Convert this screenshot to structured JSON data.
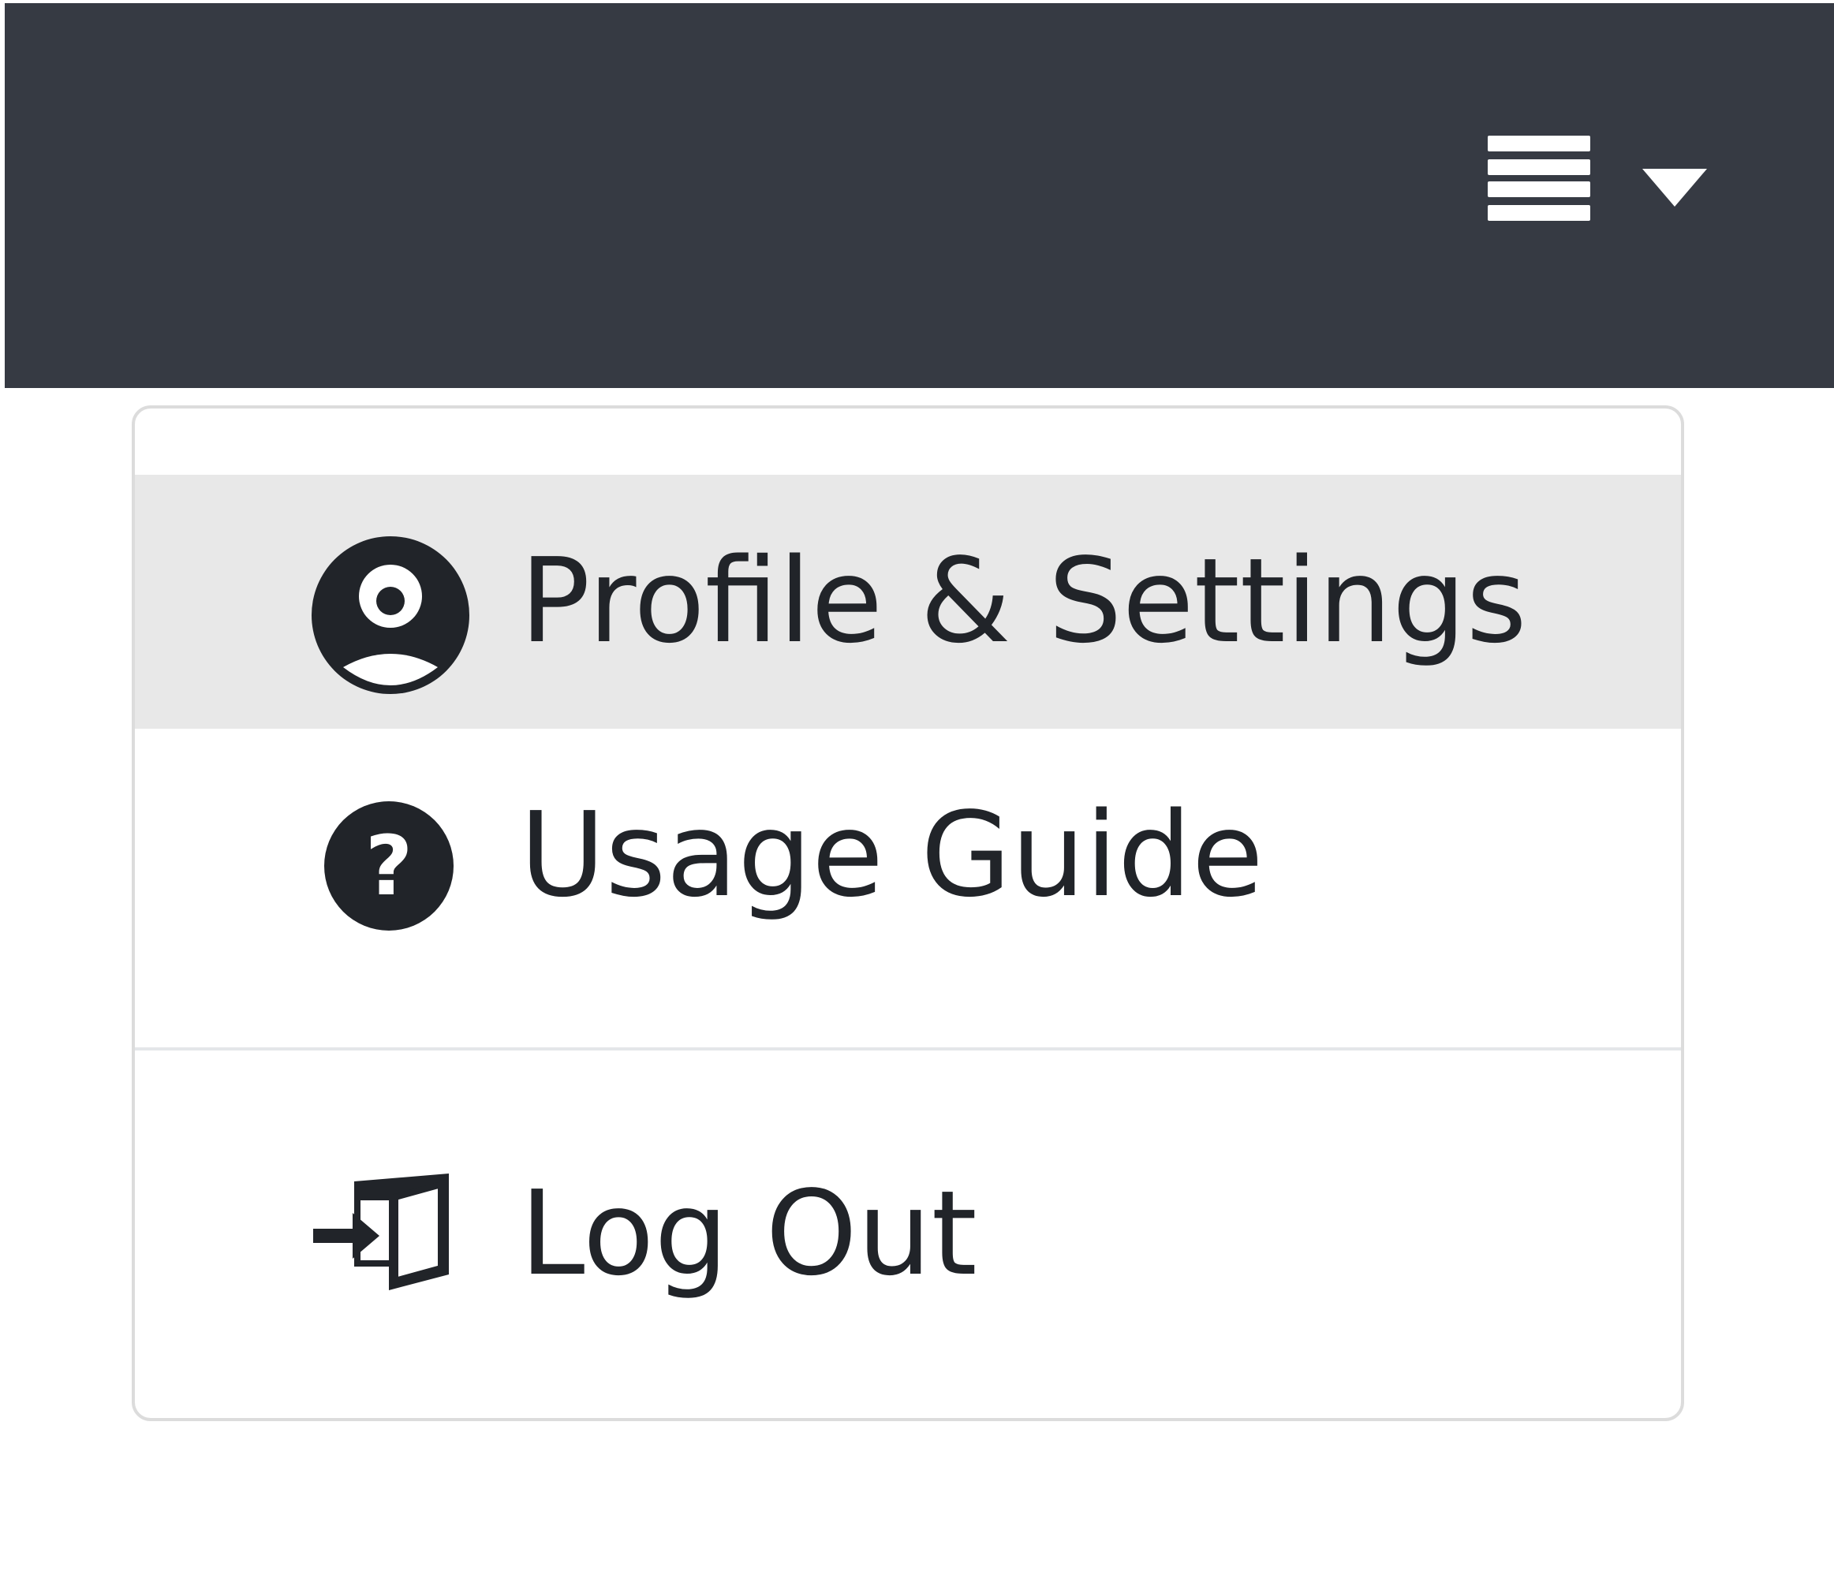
{
  "header": {
    "menu_icon": "hamburger-icon",
    "caret_icon": "caret-down-icon",
    "background_color": "#363a43"
  },
  "dropdown": {
    "items": [
      {
        "label": "Profile & Settings",
        "icon": "user-circle-icon",
        "highlighted": true
      },
      {
        "label": "Usage Guide",
        "icon": "question-circle-icon",
        "highlighted": false
      },
      {
        "label": "Log Out",
        "icon": "sign-out-icon",
        "highlighted": false
      }
    ],
    "highlight_color": "#e8e8e8",
    "text_color": "#212429"
  }
}
